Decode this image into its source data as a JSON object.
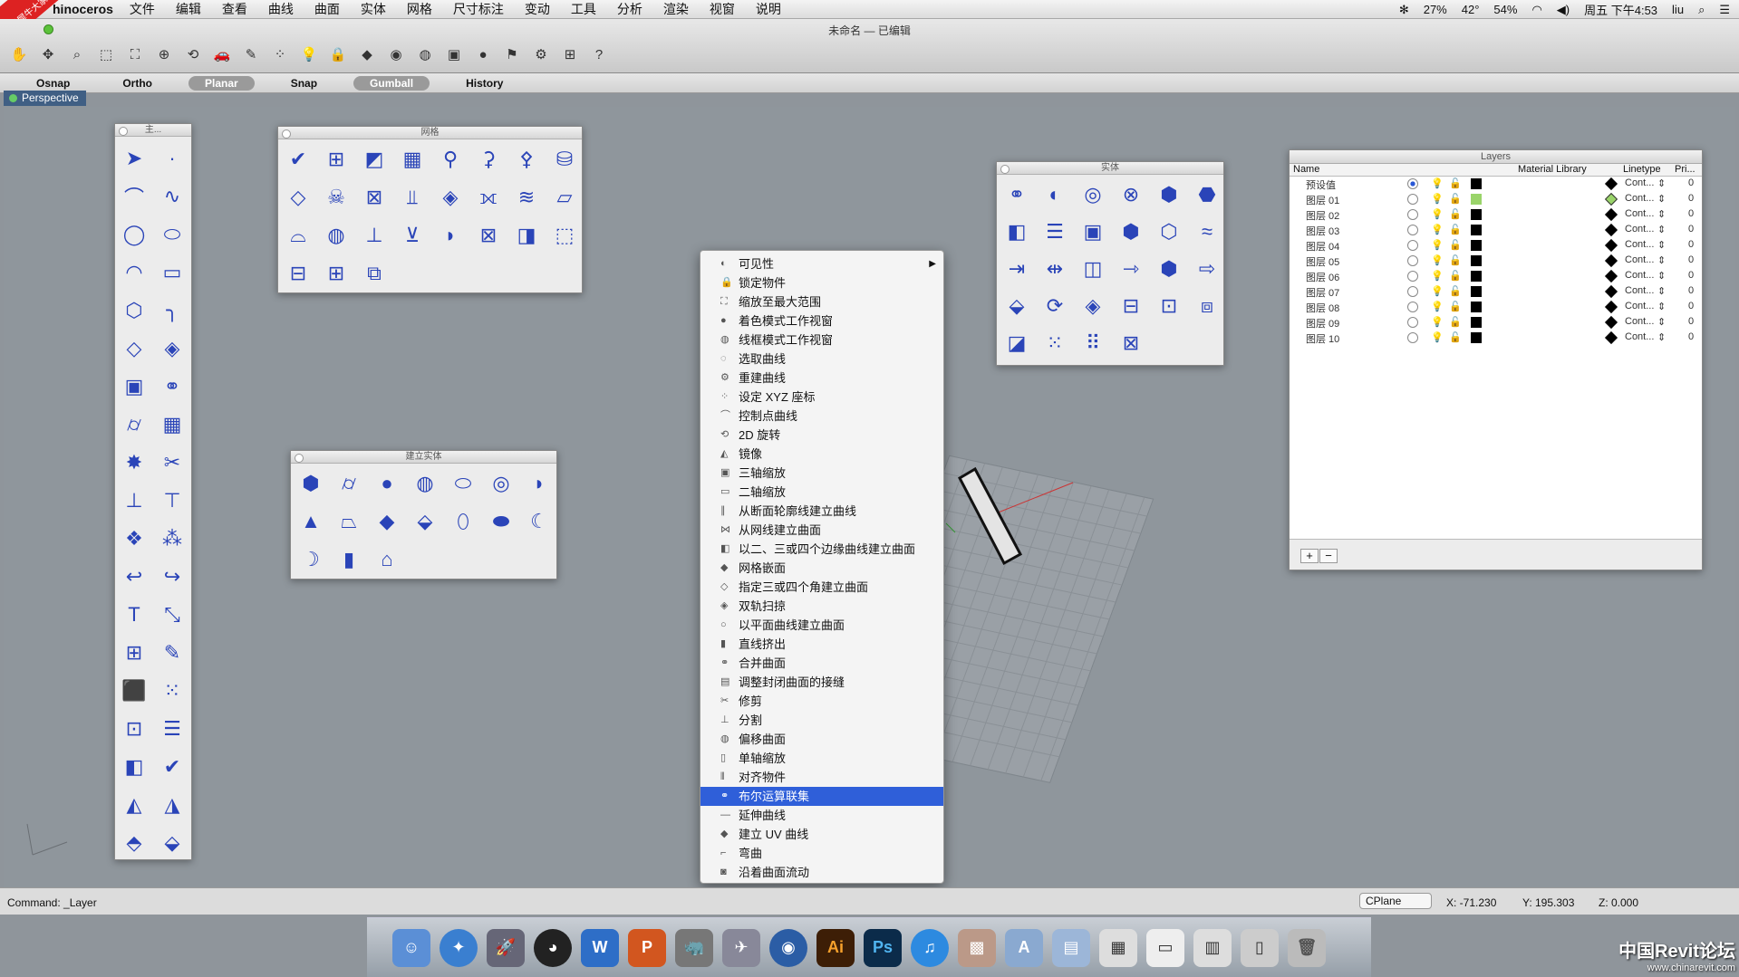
{
  "menubar": {
    "corner_badge": "学犀牛大家",
    "app_name": "hinoceros",
    "items": [
      "文件",
      "编辑",
      "查看",
      "曲线",
      "曲面",
      "实体",
      "网格",
      "尺寸标注",
      "变动",
      "工具",
      "分析",
      "渲染",
      "视窗",
      "说明"
    ],
    "status": {
      "cpu": "27%",
      "temp": "42°",
      "battery": "54%",
      "clock": "周五 下午4:53",
      "user": "liu"
    }
  },
  "window": {
    "title": "未命名 — 已编辑"
  },
  "osnap_bar": {
    "items": [
      {
        "label": "Osnap",
        "on": false
      },
      {
        "label": "Ortho",
        "on": false
      },
      {
        "label": "Planar",
        "on": true
      },
      {
        "label": "Snap",
        "on": false
      },
      {
        "label": "Gumball",
        "on": true
      },
      {
        "label": "History",
        "on": false
      }
    ]
  },
  "viewport": {
    "tab": "Perspective"
  },
  "palettes": {
    "main_title": "主...",
    "mesh_title": "网格",
    "solid_title": "实体",
    "create_solid_title": "建立实体"
  },
  "context_menu": {
    "items": [
      {
        "label": "可见性",
        "submenu": true
      },
      {
        "label": "锁定物件"
      },
      {
        "label": "缩放至最大范围"
      },
      {
        "label": "着色模式工作视窗"
      },
      {
        "label": "线框模式工作视窗"
      },
      {
        "label": "选取曲线"
      },
      {
        "label": "重建曲线"
      },
      {
        "label": "设定 XYZ 座标"
      },
      {
        "label": "控制点曲线"
      },
      {
        "label": "2D 旋转"
      },
      {
        "label": "镜像"
      },
      {
        "label": "三轴缩放"
      },
      {
        "label": "二轴缩放"
      },
      {
        "label": "从断面轮廓线建立曲线"
      },
      {
        "label": "从网线建立曲面"
      },
      {
        "label": "以二、三或四个边缘曲线建立曲面"
      },
      {
        "label": "网格嵌面"
      },
      {
        "label": "指定三或四个角建立曲面"
      },
      {
        "label": "双轨扫掠"
      },
      {
        "label": "以平面曲线建立曲面"
      },
      {
        "label": "直线挤出"
      },
      {
        "label": "合并曲面"
      },
      {
        "label": "调整封闭曲面的接缝"
      },
      {
        "label": "修剪"
      },
      {
        "label": "分割"
      },
      {
        "label": "偏移曲面"
      },
      {
        "label": "单轴缩放"
      },
      {
        "label": "对齐物件"
      },
      {
        "label": "布尔运算联集",
        "selected": true
      },
      {
        "label": "延伸曲线"
      },
      {
        "label": "建立 UV 曲线"
      },
      {
        "label": "弯曲"
      },
      {
        "label": "沿着曲面流动"
      }
    ]
  },
  "layers_panel": {
    "title": "Layers",
    "columns": {
      "name": "Name",
      "material": "Material Library",
      "linetype": "Linetype",
      "print": "Pri..."
    },
    "rows": [
      {
        "name": "预设值",
        "current": true,
        "color": "#000000",
        "linetype": "Cont...",
        "print": "0"
      },
      {
        "name": "图层 01",
        "current": false,
        "color": "#9ad46a",
        "linetype": "Cont...",
        "print": "0"
      },
      {
        "name": "图层 02",
        "current": false,
        "color": "#000000",
        "linetype": "Cont...",
        "print": "0"
      },
      {
        "name": "图层 03",
        "current": false,
        "color": "#000000",
        "linetype": "Cont...",
        "print": "0"
      },
      {
        "name": "图层 04",
        "current": false,
        "color": "#000000",
        "linetype": "Cont...",
        "print": "0"
      },
      {
        "name": "图层 05",
        "current": false,
        "color": "#000000",
        "linetype": "Cont...",
        "print": "0"
      },
      {
        "name": "图层 06",
        "current": false,
        "color": "#000000",
        "linetype": "Cont...",
        "print": "0"
      },
      {
        "name": "图层 07",
        "current": false,
        "color": "#000000",
        "linetype": "Cont...",
        "print": "0"
      },
      {
        "name": "图层 08",
        "current": false,
        "color": "#000000",
        "linetype": "Cont...",
        "print": "0"
      },
      {
        "name": "图层 09",
        "current": false,
        "color": "#000000",
        "linetype": "Cont...",
        "print": "0"
      },
      {
        "name": "图层 10",
        "current": false,
        "color": "#000000",
        "linetype": "Cont...",
        "print": "0"
      }
    ],
    "add_label": "+",
    "remove_label": "−"
  },
  "command_bar": {
    "prompt": "Command: _Layer",
    "cplane": "CPlane",
    "x": "X: -71.230",
    "y": "Y: 195.303",
    "z": "Z: 0.000"
  },
  "dock": {
    "items": [
      "Finder",
      "Safari",
      "Launchpad",
      "QQ",
      "W",
      "P",
      "Rhino",
      "Preview",
      "Aperture",
      "Ai",
      "Ps",
      "iTunes",
      "Photos",
      "Apps",
      "Documents",
      "Downloads",
      "Screen",
      "Files",
      "Phone",
      "Trash"
    ]
  },
  "watermark": {
    "main": "中国Revit论坛",
    "sub": "www.chinarevit.com"
  }
}
